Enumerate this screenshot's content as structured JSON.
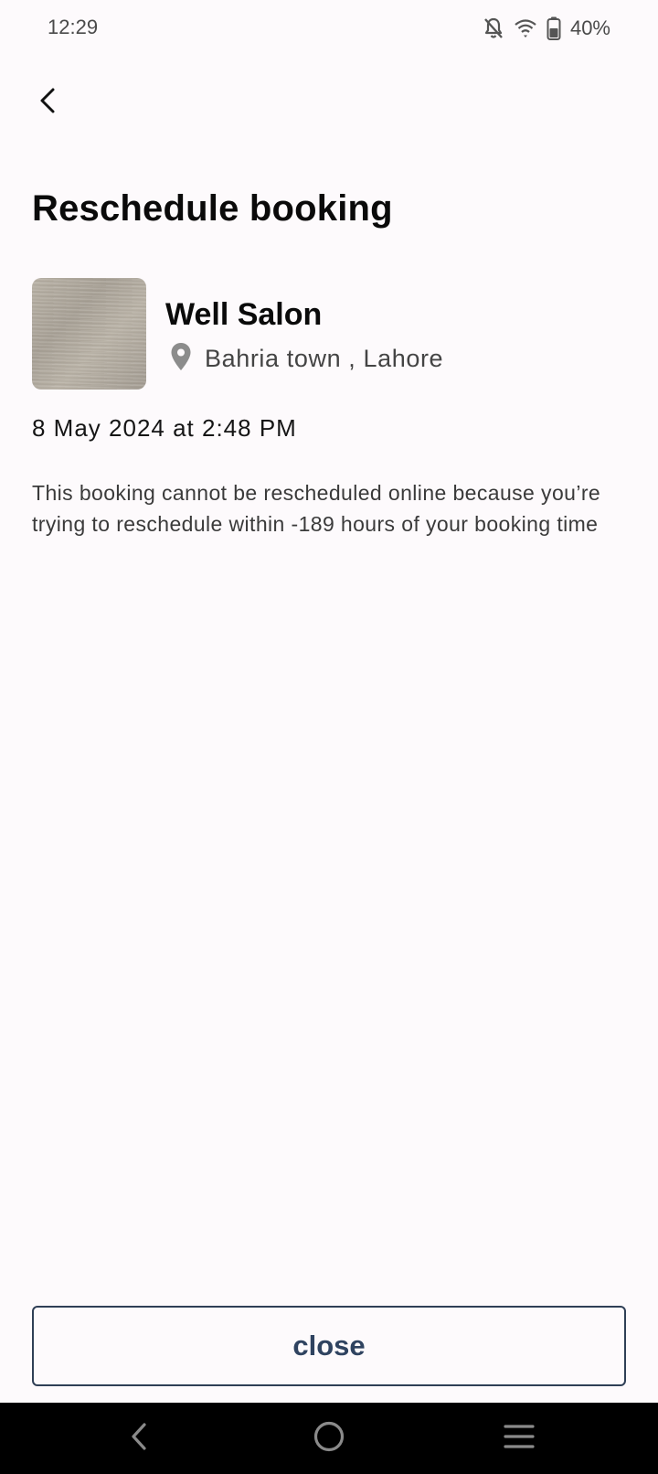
{
  "status_bar": {
    "time": "12:29",
    "battery": "40%",
    "icons": [
      "bell-off-icon",
      "wifi-icon",
      "battery-icon"
    ]
  },
  "header": {
    "back_icon": "chevron-left-icon",
    "title": "Reschedule booking"
  },
  "salon": {
    "name": "Well Salon",
    "location_icon": "map-pin-icon",
    "location": "Bahria town , Lahore"
  },
  "booking": {
    "date": "8 May 2024 at 2:48 PM",
    "message": "This booking cannot be rescheduled online because you’re trying to reschedule within -189 hours of your booking time"
  },
  "actions": {
    "close_label": "close"
  },
  "nav_bar": {
    "icons": [
      "nav-back-icon",
      "nav-home-icon",
      "nav-menu-icon"
    ]
  },
  "colors": {
    "background": "#fdfafc",
    "accent": "#2f4360",
    "nav_bar": "#000000"
  }
}
